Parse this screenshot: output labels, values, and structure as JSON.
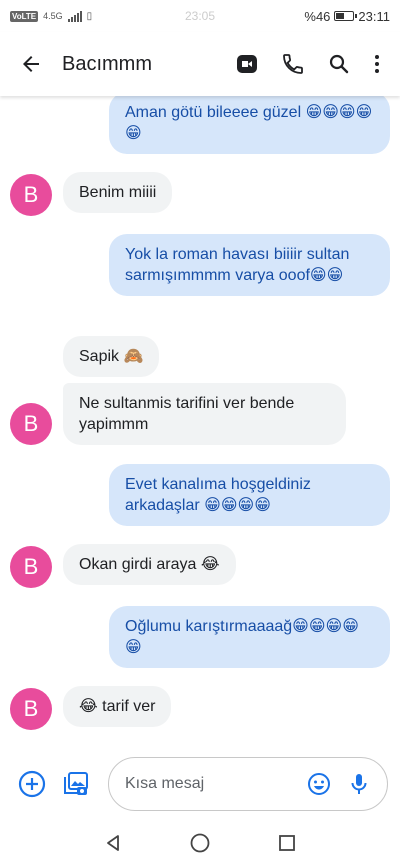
{
  "status_bar": {
    "volte": "VoLTE",
    "network": "4.5G",
    "center_time": "23:05",
    "battery": "%46",
    "battery_level": 0.46,
    "time": "23:11"
  },
  "app_bar": {
    "contact_name": "Bacımmm"
  },
  "messages": [
    {
      "direction": "out",
      "text": "Aman götü bileeee güzel 😁😁😁😁😁"
    },
    {
      "direction": "in",
      "text": "Benim miiii",
      "avatar": "B"
    },
    {
      "direction": "out",
      "text": "Yok la roman havası biiiir sultan sarmışımmmm varya ooof😁😁"
    },
    {
      "direction": "in",
      "text": "Sapik 🙈"
    },
    {
      "direction": "in",
      "text": "Ne sultanmis tarifini ver bende yapimmm",
      "avatar": "B"
    },
    {
      "direction": "out",
      "text": "Evet kanalıma hoşgeldiniz arkadaşlar 😁😁😁😁"
    },
    {
      "direction": "in",
      "text": "Okan girdi araya 😂",
      "avatar": "B"
    },
    {
      "direction": "out",
      "text": "Oğlumu karıştırmaaaağ😁😁😁😁😁"
    },
    {
      "direction": "in",
      "text": "😂 tarif ver",
      "avatar": "B"
    }
  ],
  "composer": {
    "placeholder": "Kısa mesaj"
  },
  "colors": {
    "outgoing_bubble": "#d6e6fa",
    "outgoing_text": "#174ea6",
    "incoming_bubble": "#f1f3f4",
    "avatar": "#e84c9c",
    "accent": "#1a73e8"
  },
  "icons": {
    "back": "arrow-back-icon",
    "video": "video-call-icon",
    "call": "phone-icon",
    "search": "search-icon",
    "menu": "more-vert-icon",
    "add": "add-circle-icon",
    "gallery": "gallery-icon",
    "emoji": "emoji-icon",
    "mic": "mic-icon",
    "nav_back": "nav-back-icon",
    "nav_home": "nav-home-icon",
    "nav_recents": "nav-recents-icon"
  }
}
